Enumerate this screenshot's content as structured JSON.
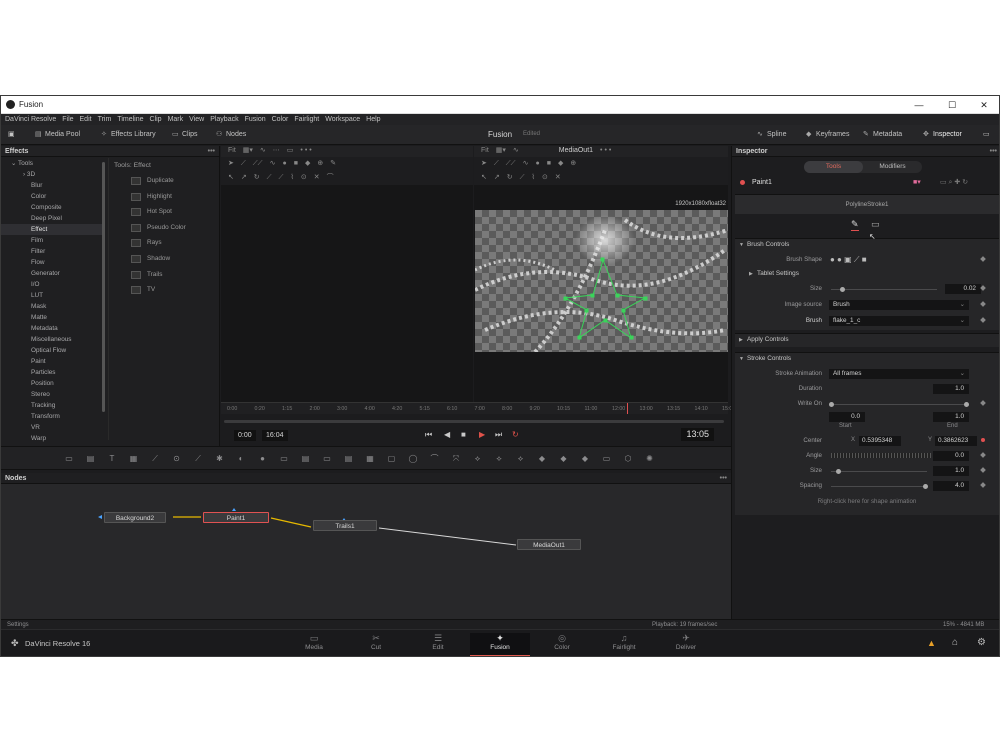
{
  "window": {
    "title": "Fusion",
    "minimize": "—",
    "maximize": "☐",
    "close": "✕"
  },
  "menu": [
    "DaVinci Resolve",
    "File",
    "Edit",
    "Trim",
    "Timeline",
    "Clip",
    "Mark",
    "View",
    "Playback",
    "Fusion",
    "Color",
    "Fairlight",
    "Workspace",
    "Help"
  ],
  "toolbar": {
    "media_pool": "Media Pool",
    "effects_library": "Effects Library",
    "clips": "Clips",
    "nodes": "Nodes",
    "page_title": "Fusion",
    "edited": "Edited",
    "spline": "Spline",
    "keyframes": "Keyframes",
    "metadata": "Metadata",
    "inspector": "Inspector"
  },
  "effects": {
    "header": "Effects",
    "tree": [
      {
        "label": "Tools",
        "level": "root"
      },
      {
        "label": "3D",
        "level": "sub"
      },
      {
        "label": "Blur",
        "level": "item"
      },
      {
        "label": "Color",
        "level": "item"
      },
      {
        "label": "Composite",
        "level": "item"
      },
      {
        "label": "Deep Pixel",
        "level": "item"
      },
      {
        "label": "Effect",
        "level": "item",
        "selected": true
      },
      {
        "label": "Film",
        "level": "item"
      },
      {
        "label": "Filter",
        "level": "item"
      },
      {
        "label": "Flow",
        "level": "item"
      },
      {
        "label": "Generator",
        "level": "item"
      },
      {
        "label": "I/O",
        "level": "item"
      },
      {
        "label": "LUT",
        "level": "item"
      },
      {
        "label": "Mask",
        "level": "item"
      },
      {
        "label": "Matte",
        "level": "item"
      },
      {
        "label": "Metadata",
        "level": "item"
      },
      {
        "label": "Miscellaneous",
        "level": "item"
      },
      {
        "label": "Optical Flow",
        "level": "item"
      },
      {
        "label": "Paint",
        "level": "item"
      },
      {
        "label": "Particles",
        "level": "item"
      },
      {
        "label": "Position",
        "level": "item"
      },
      {
        "label": "Stereo",
        "level": "item"
      },
      {
        "label": "Tracking",
        "level": "item"
      },
      {
        "label": "Transform",
        "level": "item"
      },
      {
        "label": "VR",
        "level": "item"
      },
      {
        "label": "Warp",
        "level": "item"
      }
    ],
    "list_header": "Tools: Effect",
    "list": [
      "Duplicate",
      "Highlight",
      "Hot Spot",
      "Pseudo Color",
      "Rays",
      "Shadow",
      "Trails",
      "TV"
    ]
  },
  "viewer_left": {
    "fit": "Fit"
  },
  "viewer_right": {
    "fit": "Fit",
    "output": "MediaOut1",
    "resolution": "1920x1080xfloat32"
  },
  "timeline": {
    "ticks": [
      "0:00",
      "0:20",
      "1:15",
      "2:00",
      "3:00",
      "4:00",
      "4:20",
      "5:15",
      "6:10",
      "7:00",
      "8:00",
      "9:20",
      "10:15",
      "11:00",
      "12:00",
      "13:00",
      "13:15",
      "14:10",
      "15:00"
    ],
    "start": "0:00",
    "end": "16:04",
    "current": "13:05"
  },
  "nodes": {
    "header": "Nodes",
    "items": [
      {
        "label": "Background2"
      },
      {
        "label": "Paint1"
      },
      {
        "label": "Trails1"
      },
      {
        "label": "MediaOut1"
      }
    ]
  },
  "status": {
    "left": "Settings",
    "playback": "Playback: 19 frames/sec",
    "memory": "15% - 4841 MB"
  },
  "pages": {
    "brand": "DaVinci Resolve 16",
    "tabs": [
      {
        "label": "Media",
        "icon": "▭"
      },
      {
        "label": "Cut",
        "icon": "✂"
      },
      {
        "label": "Edit",
        "icon": "☰"
      },
      {
        "label": "Fusion",
        "icon": "✦",
        "active": true
      },
      {
        "label": "Color",
        "icon": "◎"
      },
      {
        "label": "Fairlight",
        "icon": "♫"
      },
      {
        "label": "Deliver",
        "icon": "✈"
      }
    ]
  },
  "inspector": {
    "header": "Inspector",
    "tab_tools": "Tools",
    "tab_modifiers": "Modifiers",
    "tool_name": "Paint1",
    "sub_tool": "PolylineStroke1",
    "brush_controls": "Brush Controls",
    "brush_shape": "Brush Shape",
    "tablet_settings": "Tablet Settings",
    "size_label": "Size",
    "size_value": "0.02",
    "size_level": 0.1,
    "image_source_label": "Image source",
    "image_source_value": "Brush",
    "brush_label": "Brush",
    "brush_value": "flake_1_c",
    "apply_controls": "Apply Controls",
    "stroke_controls": "Stroke Controls",
    "stroke_animation_label": "Stroke Animation",
    "stroke_animation_value": "All frames",
    "duration_label": "Duration",
    "duration_value": "1.0",
    "write_on_label": "Write On",
    "write_on_start": "0.0",
    "write_on_end": "1.0",
    "start_label": "Start",
    "end_label": "End",
    "center_label": "Center",
    "center_x_label": "X",
    "center_x": "0.5395348",
    "center_y_label": "Y",
    "center_y": "0.3862623",
    "angle_label": "Angle",
    "angle_value": "0.0",
    "size2_label": "Size",
    "size2_value": "1.0",
    "spacing_label": "Spacing",
    "spacing_value": "4.0",
    "spacing_level": 0.98,
    "hint": "Right-click here for shape animation"
  },
  "colors": {
    "accent": "#e05a4f",
    "node_link_yellow": "#e6b800",
    "node_link_white": "#d9d9d9",
    "stroke_green": "#3ad45a"
  }
}
